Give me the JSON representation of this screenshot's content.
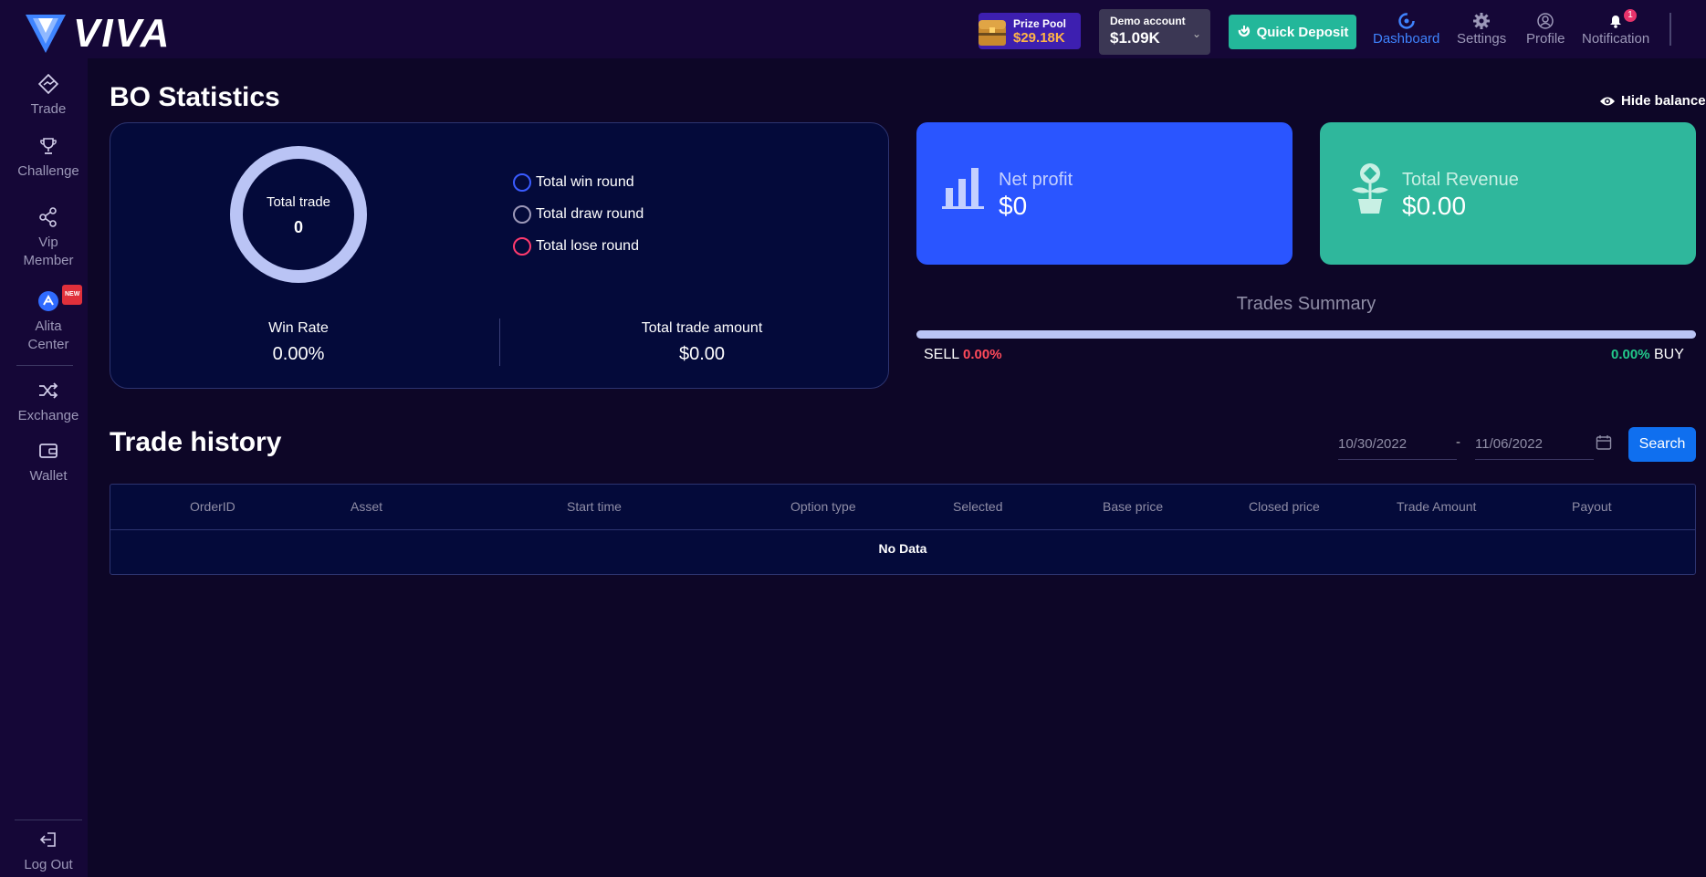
{
  "header": {
    "logo_text": "VIVA",
    "prize_pool": {
      "label": "Prize Pool",
      "amount": "$29.18K"
    },
    "account": {
      "label": "Demo account",
      "amount": "$1.09K"
    },
    "quick_deposit_label": "Quick Deposit",
    "nav": [
      {
        "label": "Dashboard",
        "icon": "dashboard-icon",
        "active": true
      },
      {
        "label": "Settings",
        "icon": "gear-icon"
      },
      {
        "label": "Profile",
        "icon": "user-icon"
      },
      {
        "label": "Notification",
        "icon": "bell-icon",
        "badge": "1"
      }
    ]
  },
  "sidebar": {
    "items": [
      {
        "label": "Trade",
        "icon": "trade-icon"
      },
      {
        "label": "Challenge",
        "icon": "trophy-icon"
      },
      {
        "label": "Vip Member",
        "icon": "share-icon"
      },
      {
        "label": "Alita Center",
        "icon": "alita-icon",
        "badge": "NEW"
      },
      {
        "label": "Exchange",
        "icon": "shuffle-icon"
      },
      {
        "label": "Wallet",
        "icon": "wallet-icon"
      }
    ],
    "logout_label": "Log Out"
  },
  "stats": {
    "title": "BO Statistics",
    "hide_balance": "Hide balance",
    "donut_label": "Total trade",
    "donut_value": "0",
    "legend": [
      {
        "label": "Total win round",
        "color": "#3a5bff"
      },
      {
        "label": "Total draw round",
        "color": "#9c98b8"
      },
      {
        "label": "Total lose round",
        "color": "#ff3a6e"
      }
    ],
    "win_rate_label": "Win Rate",
    "win_rate_value": "0.00%",
    "trade_amount_label": "Total trade amount",
    "trade_amount_value": "$0.00"
  },
  "cards": {
    "net_profit": {
      "label": "Net profit",
      "value": "$0"
    },
    "total_revenue": {
      "label": "Total Revenue",
      "value": "$0.00"
    }
  },
  "summary": {
    "title": "Trades Summary",
    "sell_label": "SELL",
    "sell_value": "0.00%",
    "buy_label": "BUY",
    "buy_value": "0.00%"
  },
  "history": {
    "title": "Trade history",
    "date_from": "10/30/2022",
    "date_to": "11/06/2022",
    "date_sep": "-",
    "search_label": "Search",
    "columns": [
      "OrderID",
      "Asset",
      "Start time",
      "Option type",
      "Selected",
      "Base price",
      "Closed price",
      "Trade Amount",
      "Payout"
    ],
    "empty_text": "No Data"
  },
  "colors": {
    "accent": "#3f84ff",
    "net_profit_card": "#2a55ff",
    "revenue_card": "#2fb79c",
    "quick_deposit": "#23b79a"
  }
}
